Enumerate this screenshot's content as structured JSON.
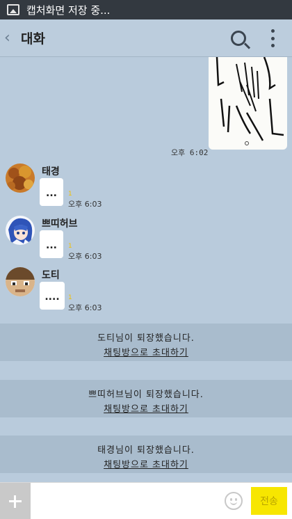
{
  "statusbar": {
    "notification_text": "캡처화면 저장 중..."
  },
  "header": {
    "back_label": "‹",
    "title": "대화"
  },
  "image_message": {
    "time": "오후 6:02"
  },
  "messages": [
    {
      "name": "태경",
      "text": "...",
      "unread": "1",
      "time": "오후 6:03"
    },
    {
      "name": "쁘띠허브",
      "text": "...",
      "unread": "1",
      "time": "오후 6:03"
    },
    {
      "name": "도티",
      "text": "....",
      "unread": "1",
      "time": "오후 6:03"
    }
  ],
  "notices": [
    {
      "text": "도티님이 퇴장했습니다.",
      "link": "채팅방으로 초대하기"
    },
    {
      "text": "쁘띠허브님이 퇴장했습니다.",
      "link": "채팅방으로 초대하기"
    },
    {
      "text": "태경님이 퇴장했습니다.",
      "link": "채팅방으로 초대하기"
    }
  ],
  "input": {
    "placeholder": "",
    "send_label": "전송"
  },
  "colors": {
    "background": "#b9cbdc",
    "send_button": "#f7e600",
    "unread": "#f2c000"
  }
}
